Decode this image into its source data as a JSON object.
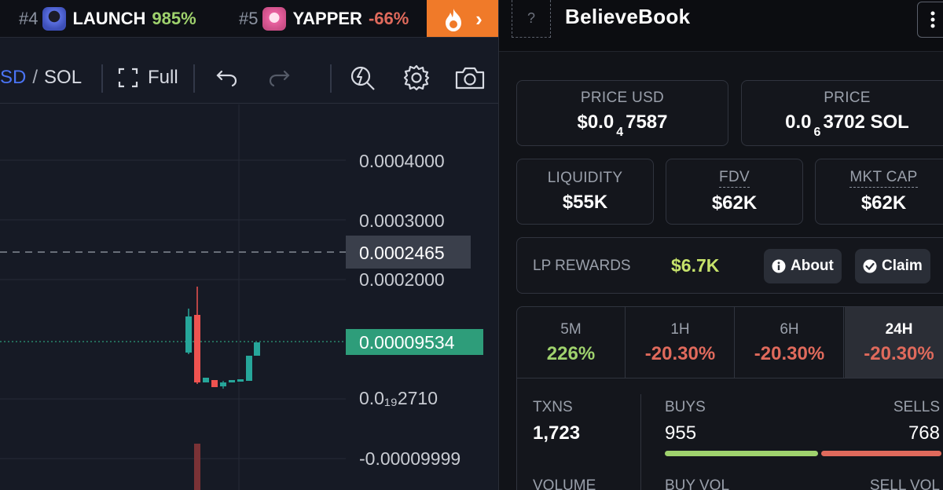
{
  "ticker": [
    {
      "rank": "#4",
      "name": "LAUNCH",
      "change": "985%",
      "direction": "up",
      "avatar_color": "#4a5fd0"
    },
    {
      "rank": "#5",
      "name": "YAPPER",
      "change": "-66%",
      "direction": "down",
      "avatar_color": "#e05a9a"
    }
  ],
  "toolbar": {
    "pair_usd": "SD",
    "pair_sep": "/",
    "pair_sol": "SOL",
    "full_label": "Full"
  },
  "chart": {
    "price_labels": [
      "0.0004000",
      "0.0003000",
      "0.0002000",
      "0.0₁₉2710",
      "-0.00009999"
    ],
    "crosshair_price": "0.0002465",
    "current_price": "0.00009534",
    "colors": {
      "up": "#26a69a",
      "down": "#ef5350",
      "current_tag": "#2e9d7a"
    }
  },
  "header": {
    "title": "BelieveBook",
    "logo_placeholder": "?"
  },
  "prices": {
    "usd_label": "PRICE USD",
    "usd_prefix": "$0.0",
    "usd_zeros": "4",
    "usd_digits": "7587",
    "native_label": "PRICE",
    "native_prefix": "0.0",
    "native_zeros": "6",
    "native_digits": "3702 SOL"
  },
  "metrics": [
    {
      "label": "LIQUIDITY",
      "value": "$55K"
    },
    {
      "label": "FDV",
      "value": "$62K"
    },
    {
      "label": "MKT CAP",
      "value": "$62K"
    }
  ],
  "lp_rewards": {
    "label": "LP REWARDS",
    "value": "$6.7K",
    "about_label": "About",
    "claim_label": "Claim"
  },
  "timeframes": [
    {
      "label": "5M",
      "value": "226%",
      "direction": "up"
    },
    {
      "label": "1H",
      "value": "-20.30%",
      "direction": "down"
    },
    {
      "label": "6H",
      "value": "-20.30%",
      "direction": "down"
    },
    {
      "label": "24H",
      "value": "-20.30%",
      "direction": "down",
      "active": true
    }
  ],
  "stats": {
    "txns_label": "TXNS",
    "txns_value": "1,723",
    "buys_label": "BUYS",
    "buys_value": "955",
    "sells_label": "SELLS",
    "sells_value": "768",
    "buy_ratio": 0.554,
    "volume_label": "VOLUME",
    "buy_vol_label": "BUY VOL",
    "sell_vol_label": "SELL VOL",
    "colors": {
      "buy": "#9fd26d",
      "sell": "#e06a5c"
    }
  }
}
